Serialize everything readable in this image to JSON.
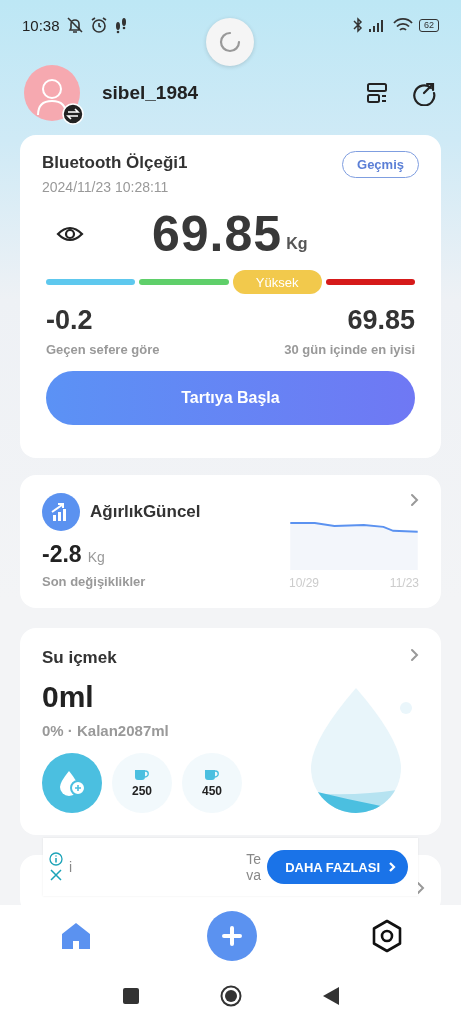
{
  "status_bar": {
    "time": "10:38",
    "battery": "62"
  },
  "profile": {
    "username": "sibel_1984"
  },
  "scale_card": {
    "title": "Bluetooth Ölçeği1",
    "timestamp": "2024/11/23 10:28:11",
    "history_button": "Geçmiş",
    "weight": "69.85",
    "unit": "Kg",
    "segments": [
      {
        "color": "#5ec8ee",
        "selected": false
      },
      {
        "color": "#5fcf6a",
        "selected": false
      },
      {
        "color": "#f2c94c",
        "selected": true,
        "label": "Yüksek"
      },
      {
        "color": "#d61a1a",
        "selected": false
      }
    ],
    "change": "-0.2",
    "change_label": "Geçen sefere göre",
    "best": "69.85",
    "best_label": "30 gün içinde en iyisi",
    "start_button": "Tartıya Başla"
  },
  "trend_card": {
    "title": "AğırlıkGüncel",
    "change": "-2.8",
    "unit": "Kg",
    "caption": "Son değişiklikler",
    "x_labels": [
      "10/29",
      "11/23"
    ]
  },
  "water_card": {
    "title": "Su içmek",
    "amount": "0ml",
    "progress": "0% · Kalan2087ml",
    "cups": [
      {
        "kind": "add"
      },
      {
        "kind": "cup",
        "label": "250"
      },
      {
        "kind": "cup",
        "label": "450"
      }
    ]
  },
  "ad": {
    "text_1": "i",
    "text_2": "Te",
    "text_3": "va",
    "button": "DAHA FAZLASI"
  },
  "bottom_nav": {
    "items": [
      {
        "kind": "home",
        "selected": true
      },
      {
        "kind": "settings",
        "selected": false
      }
    ]
  }
}
